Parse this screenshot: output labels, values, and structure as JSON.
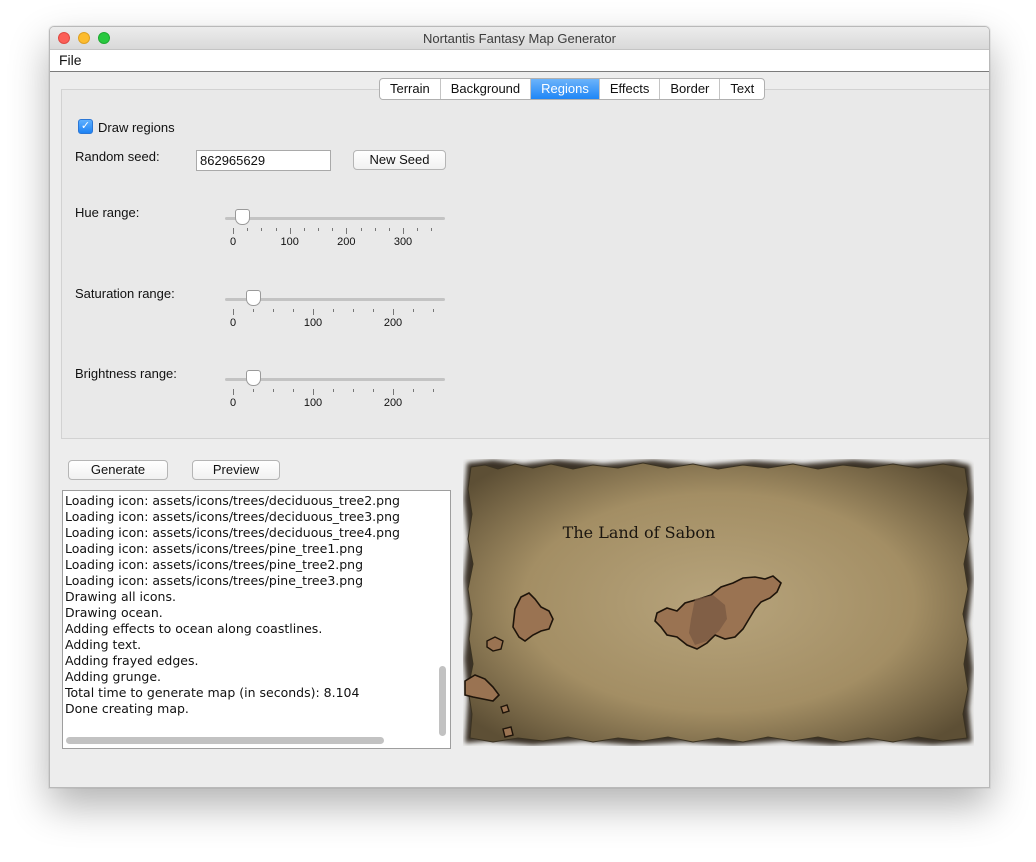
{
  "window": {
    "title": "Nortantis Fantasy Map Generator"
  },
  "menu": {
    "file": "File"
  },
  "tabs": [
    {
      "label": "Terrain",
      "active": false
    },
    {
      "label": "Background",
      "active": false
    },
    {
      "label": "Regions",
      "active": true
    },
    {
      "label": "Effects",
      "active": false
    },
    {
      "label": "Border",
      "active": false
    },
    {
      "label": "Text",
      "active": false
    }
  ],
  "regions": {
    "draw_regions_label": "Draw regions",
    "draw_regions_checked": true,
    "random_seed_label": "Random seed:",
    "random_seed_value": "862965629",
    "new_seed_label": "New Seed",
    "hue_label": "Hue range:",
    "hue_value": 16,
    "hue_ticks": [
      "0",
      "100",
      "200",
      "300"
    ],
    "saturation_label": "Saturation range:",
    "saturation_value": 25,
    "saturation_ticks": [
      "0",
      "100",
      "200"
    ],
    "brightness_label": "Brightness range:",
    "brightness_value": 25,
    "brightness_ticks": [
      "0",
      "100",
      "200"
    ]
  },
  "actions": {
    "generate_label": "Generate",
    "preview_label": "Preview"
  },
  "log": [
    "Loading icon: assets/icons/trees/deciduous_tree2.png",
    "Loading icon: assets/icons/trees/deciduous_tree3.png",
    "Loading icon: assets/icons/trees/deciduous_tree4.png",
    "Loading icon: assets/icons/trees/pine_tree1.png",
    "Loading icon: assets/icons/trees/pine_tree2.png",
    "Loading icon: assets/icons/trees/pine_tree3.png",
    "Drawing all icons.",
    "Drawing ocean.",
    "Adding effects to ocean along coastlines.",
    "Adding text.",
    "Adding frayed edges.",
    "Adding grunge.",
    "Total time to generate map (in seconds): 8.104",
    "Done creating map."
  ],
  "map": {
    "title": "The Land of Sabon",
    "parchment_color": "#a38e64",
    "edge_color": "#2b2418"
  }
}
